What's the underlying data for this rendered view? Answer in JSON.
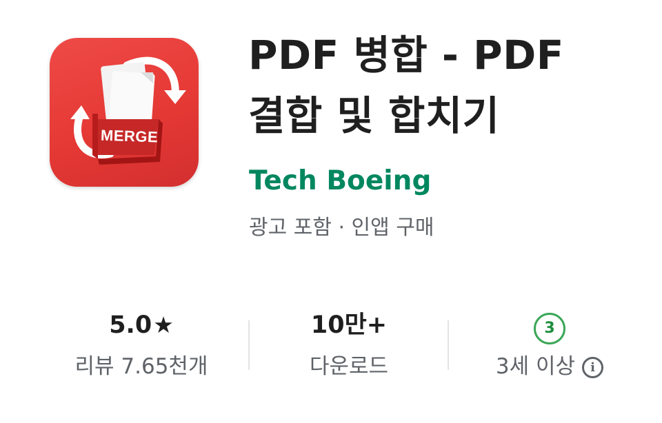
{
  "app": {
    "title_line1": "PDF 병합 - PDF",
    "title_line2": "결합 및 합치기",
    "developer": "Tech Boeing",
    "meta": "광고 포함 · 인앱 구매",
    "icon_label": "MERGE",
    "icon_name": "merge-document-icon"
  },
  "stats": {
    "rating": {
      "value": "5.0",
      "star": "★",
      "label": "리뷰 7.65천개"
    },
    "downloads": {
      "value": "10만+",
      "label": "다운로드"
    },
    "age": {
      "badge": "3",
      "label": "3세 이상",
      "info_icon": "i"
    }
  },
  "colors": {
    "developer": "#01875f",
    "icon_background": "#e53935",
    "age_badge": "#3aa757",
    "secondary_text": "#5f6368"
  }
}
